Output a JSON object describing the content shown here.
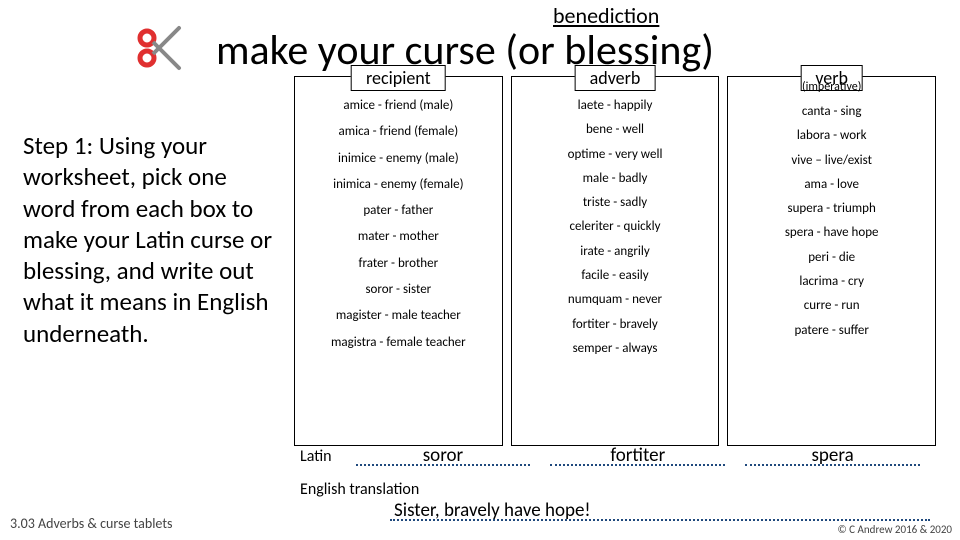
{
  "header": {
    "benediction": "benediction",
    "title": "make your curse (or blessing)"
  },
  "instructions": "Step 1: Using your worksheet, pick one word from each box to make your Latin curse or blessing, and write out what it means in English underneath.",
  "columns": {
    "recipient": {
      "label": "recipient",
      "items": [
        "amice - friend (male)",
        "amica - friend (female)",
        "inimice - enemy (male)",
        "inimica - enemy (female)",
        "pater - father",
        "mater - mother",
        "frater - brother",
        "soror - sister",
        "magister - male teacher",
        "magistra - female teacher"
      ]
    },
    "adverb": {
      "label": "adverb",
      "items": [
        "laete - happily",
        "bene - well",
        "optime - very well",
        "male - badly",
        "triste - sadly",
        "celeriter - quickly",
        "irate - angrily",
        "facile - easily",
        "numquam - never",
        "fortiter - bravely",
        "semper - always"
      ]
    },
    "verb": {
      "label": "verb",
      "subtitle": "(imperative)",
      "items": [
        "canta - sing",
        "labora - work",
        "vive – live/exist",
        "ama - love",
        "supera - triumph",
        "spera - have hope",
        "peri - die",
        "lacrima - cry",
        "curre - run",
        "patere - suffer"
      ]
    }
  },
  "fill": {
    "latin_label": "Latin",
    "blank1": "soror",
    "blank2": "fortiter",
    "blank3": "spera",
    "translation_label": "English translation",
    "translation": "Sister, bravely have hope!"
  },
  "footer": {
    "left": "3.03 Adverbs & curse tablets",
    "right": "© C Andrew 2016 & 2020"
  }
}
